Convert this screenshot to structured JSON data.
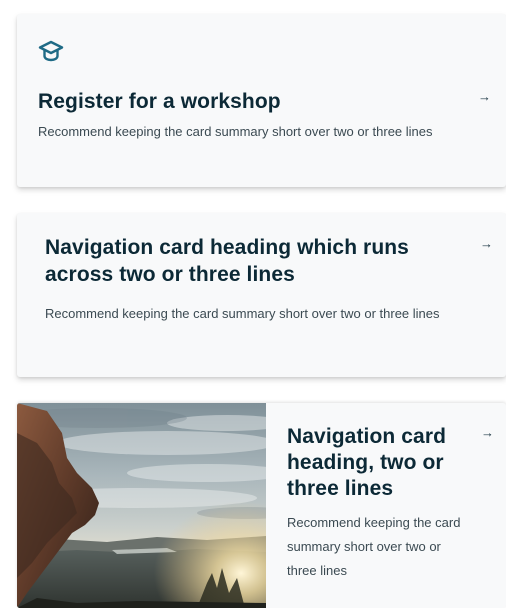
{
  "cards": [
    {
      "icon": "graduation-cap-icon",
      "heading": "Register for a workshop",
      "summary": "Recommend keeping the card summary short over two or three lines",
      "arrow": "→"
    },
    {
      "heading": "Navigation card heading which runs across two or three lines",
      "summary": "Recommend keeping the card summary short over two or three lines",
      "arrow": "→"
    },
    {
      "image": "landscape-cliff-sunset-photo",
      "heading": "Navigation card heading, two or three lines",
      "summary": "Recommend keeping the card summary short over two or three lines",
      "arrow": "→"
    }
  ],
  "colors": {
    "heading": "#0c2936",
    "accent_icon": "#1f6b86",
    "card_bg": "#f8f9fa"
  }
}
